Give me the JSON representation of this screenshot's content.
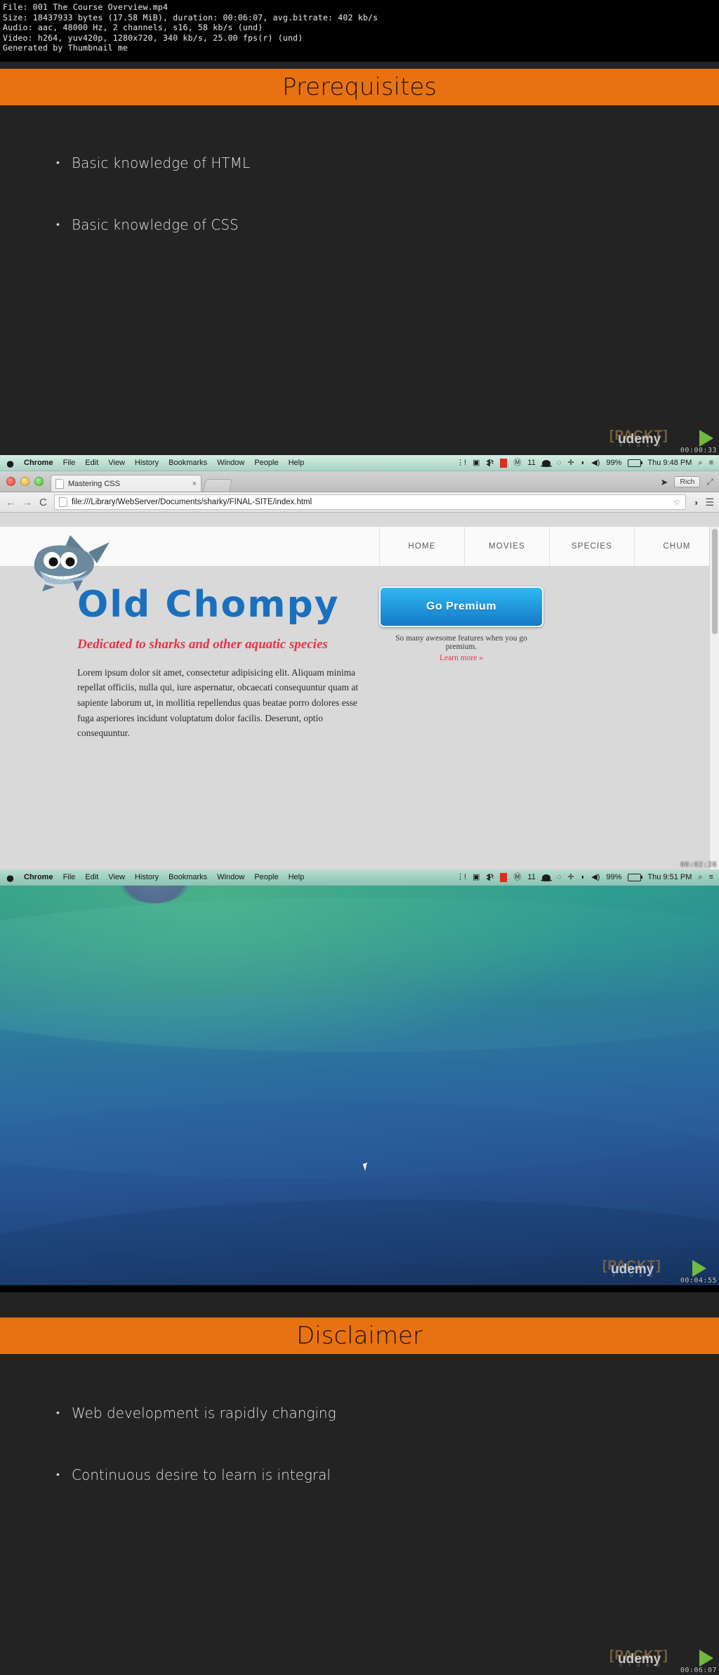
{
  "video_info": {
    "lines": [
      "File: 001 The Course Overview.mp4",
      "Size: 18437933 bytes (17.58 MiB), duration: 00:06:07, avg.bitrate: 402 kb/s",
      "Audio: aac, 48000 Hz, 2 channels, s16, 58 kb/s (und)",
      "Video: h264, yuv420p, 1280x720, 340 kb/s, 25.00 fps(r) (und)",
      "Generated by Thumbnail me"
    ],
    "file_name": "001 The Course Overview.mp4",
    "size": "18437933 bytes (17.58 MiB)",
    "duration": "00:06:07",
    "avg_bitrate": "402 kb/s",
    "audio": "aac, 48000 Hz, 2 channels, s16, 58 kb/s (und)",
    "video": "h264, yuv420p, 1280x720, 340 kb/s, 25.00 fps(r) (und)",
    "generator": "Generated by Thumbnail me"
  },
  "watermark": {
    "packt": "PACKT",
    "udemy": "udemy",
    "video": "V I D E O",
    "bracket_open": "[",
    "bracket_close": "]"
  },
  "colors": {
    "slide_bg": "#232323",
    "slide_accent": "#e87211",
    "heading_blue": "#1a70bf",
    "accent_red": "#e8334a",
    "premium_blue": "#1479c8",
    "packt_gold": "#8a6a42",
    "play_green": "#7ac943"
  },
  "frames": [
    {
      "kind": "slide",
      "timestamp": "00:00:33",
      "title": "Prerequisites",
      "bullets": [
        "Basic knowledge of HTML",
        "Basic knowledge of CSS"
      ]
    },
    {
      "kind": "browser",
      "timestamp": "00:02:28"
    },
    {
      "kind": "desktop",
      "timestamp": "00:04:55"
    },
    {
      "kind": "slide",
      "timestamp": "00:06:07",
      "title": "Disclaimer",
      "bullets": [
        "Web development is rapidly changing",
        "Continuous desire to learn is integral"
      ]
    }
  ],
  "menubar_1": {
    "apple": "apple-logo",
    "items": [
      "Chrome",
      "File",
      "Edit",
      "View",
      "History",
      "Bookmarks",
      "Window",
      "People",
      "Help"
    ],
    "status": {
      "layers_count": "11",
      "battery_percent": "99%",
      "clock": "Thu 9:48 PM",
      "search": "⌕",
      "notifications": "≡"
    }
  },
  "menubar_2": {
    "items": [
      "Chrome",
      "File",
      "Edit",
      "View",
      "History",
      "Bookmarks",
      "Window",
      "People",
      "Help"
    ],
    "status": {
      "layers_count": "11",
      "battery_percent": "99%",
      "clock": "Thu 9:51 PM",
      "search": "⌕",
      "notifications": "≡"
    }
  },
  "browser": {
    "tab_title": "Mastering CSS",
    "tab_close": "×",
    "new_tab": "+",
    "back": "←",
    "forward": "→",
    "reload": "C",
    "url": "file:///Library/WebServer/Documents/sharky/FINAL-SITE/index.html",
    "star": "☆",
    "extension": "◑",
    "menu": "☰",
    "user_chip": "Rich",
    "fullscreen": "⤢"
  },
  "site": {
    "logo": "shark-mascot",
    "nav": [
      "HOME",
      "MOVIES",
      "SPECIES",
      "CHUM"
    ],
    "heading": "Old Chompy",
    "subheading": "Dedicated to sharks and other aquatic species",
    "paragraph": "Lorem ipsum dolor sit amet, consectetur adipisicing elit. Aliquam minima repellat officiis, nulla qui, iure aspernatur, obcaecati consequuntur quam at sapiente laborum ut, in mollitia repellendus quas beatae porro dolores esse fuga asperiores incidunt voluptatum dolor facilis. Deserunt, optio consequuntur.",
    "premium_button": "Go Premium",
    "premium_sub": "So many awesome features when you go premium.",
    "premium_link": "Learn more »"
  }
}
